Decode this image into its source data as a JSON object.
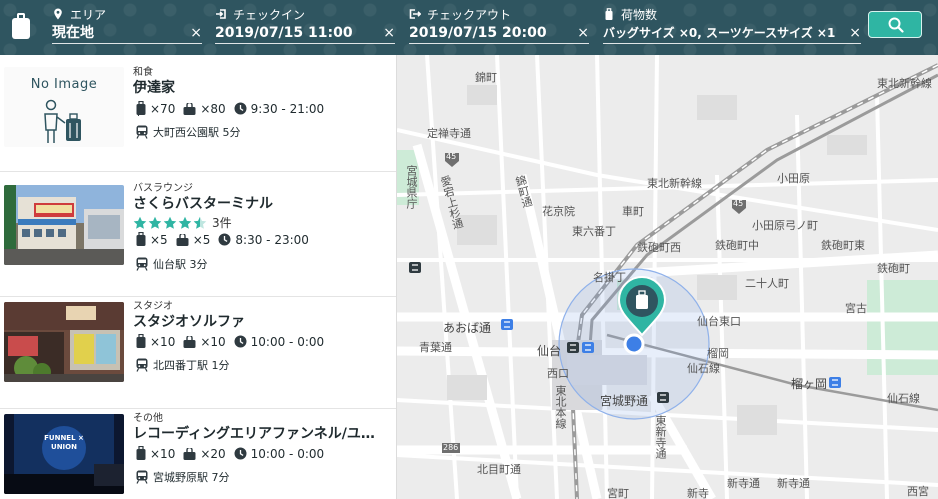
{
  "header": {
    "area": {
      "label": "エリア",
      "value": "現在地"
    },
    "checkin": {
      "label": "チェックイン",
      "value": "2019/07/15 11:00"
    },
    "checkout": {
      "label": "チェックアウト",
      "value": "2019/07/15 20:00"
    },
    "luggage": {
      "label": "荷物数",
      "value": "バッグサイズ ×0, スーツケースサイズ ×1"
    },
    "clear_symbol": "×",
    "accent_color": "#2fb5a3",
    "bar_color": "#2f5560"
  },
  "listings": [
    {
      "category": "和食",
      "name": "伊達家",
      "image_text": "No Image",
      "suitcase": "×70",
      "bag": "×80",
      "hours": "9:30 - 21:00",
      "station": "大町西公園駅 5分"
    },
    {
      "category": "バスラウンジ",
      "name": "さくらバスターミナル",
      "rating": 4.5,
      "reviews": "3件",
      "suitcase": "×5",
      "bag": "×5",
      "hours": "8:30 - 23:00",
      "station": "仙台駅 3分"
    },
    {
      "category": "スタジオ",
      "name": "スタジオソルファ",
      "suitcase": "×10",
      "bag": "×10",
      "hours": "10:00 - 0:00",
      "station": "北四番丁駅 1分"
    },
    {
      "category": "その他",
      "name": "レコーディングエリアファンネル/ユ…",
      "image_text": "FUNNEL × UNION",
      "suitcase": "×10",
      "bag": "×20",
      "hours": "10:00 - 0:00",
      "station": "宮城野原駅 7分"
    }
  ],
  "map": {
    "labels": {
      "l1": "錦町",
      "l2": "定禅寺通",
      "l3": "宮城県庁",
      "l4": "愛宕上杉通",
      "l5": "錦町通",
      "l6": "花京院",
      "l7": "東六番丁",
      "l8": "車町",
      "l9": "鉄砲町西",
      "l10": "鉄砲町中",
      "l11": "鉄砲町東",
      "l12": "小田原",
      "l13": "小田原弓ノ町",
      "l14": "鉄砲町",
      "l15": "二十人町",
      "l16": "名掛丁",
      "l17": "あおば通",
      "l18": "青葉通",
      "l19": "仙台",
      "l20": "榴岡",
      "l21": "仙石線",
      "l22": "宮城野通",
      "l23": "榴ヶ岡",
      "l24": "仙石線",
      "l25": "北目町通",
      "l26": "東北本線",
      "l27": "新寺通",
      "l28": "新寺",
      "l29": "東新寺通",
      "l30": "宮町",
      "l31": "東北新幹線",
      "l32": "仙台東口",
      "l33": "西口",
      "l34": "宮古",
      "l35": "東北新幹線",
      "l36": "新寺通",
      "l37": "西宮"
    },
    "route_numbers": {
      "r1": "45",
      "r2": "45",
      "r3": "286"
    },
    "station_marker_color": "#3d7fe6"
  }
}
